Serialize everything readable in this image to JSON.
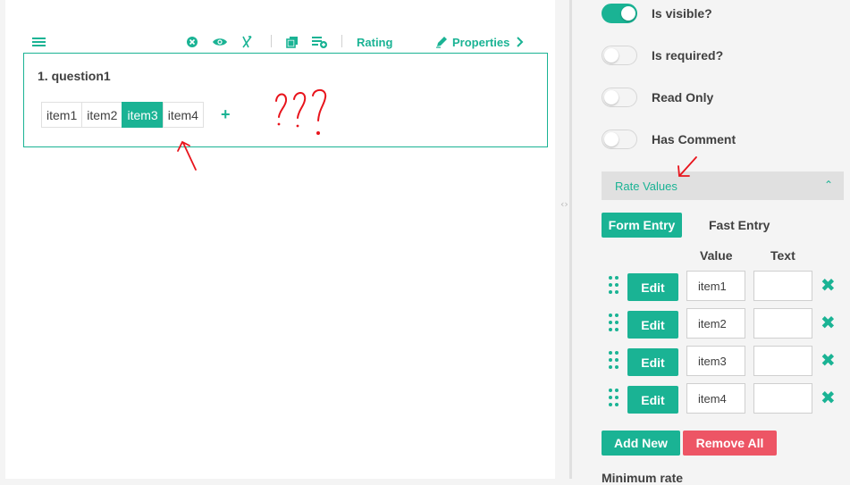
{
  "toolbar": {
    "items": [
      {
        "icon": "hamburger-menu-icon"
      },
      {
        "icon": "delete-circle-icon"
      },
      {
        "icon": "eye-icon"
      },
      {
        "icon": "required-toggle-icon"
      },
      {
        "icon": "copy-icon"
      },
      {
        "icon": "add-to-toolbox-icon"
      }
    ],
    "question_type_label": "Rating",
    "properties_label": "Properties"
  },
  "question": {
    "title": "1. question1",
    "rate_items": [
      "item1",
      "item2",
      "item3",
      "item4"
    ],
    "selected_index": 2,
    "add_label": "+"
  },
  "properties": {
    "toggles": [
      {
        "label": "Is visible?",
        "on": true
      },
      {
        "label": "Is required?",
        "on": false
      },
      {
        "label": "Read Only",
        "on": false
      },
      {
        "label": "Has Comment",
        "on": false
      }
    ],
    "section_title": "Rate Values",
    "tabs": {
      "form_entry": "Form Entry",
      "fast_entry": "Fast Entry"
    },
    "columns": {
      "value": "Value",
      "text": "Text"
    },
    "rows": [
      {
        "edit_label": "Edit",
        "value": "item1",
        "text": ""
      },
      {
        "edit_label": "Edit",
        "value": "item2",
        "text": ""
      },
      {
        "edit_label": "Edit",
        "value": "item3",
        "text": ""
      },
      {
        "edit_label": "Edit",
        "value": "item4",
        "text": ""
      }
    ],
    "add_new_label": "Add New",
    "remove_all_label": "Remove All",
    "minimum_rate_label": "Minimum rate"
  },
  "colors": {
    "accent": "#1ab394",
    "danger": "#ed5565",
    "annotation": "#e8141c"
  }
}
